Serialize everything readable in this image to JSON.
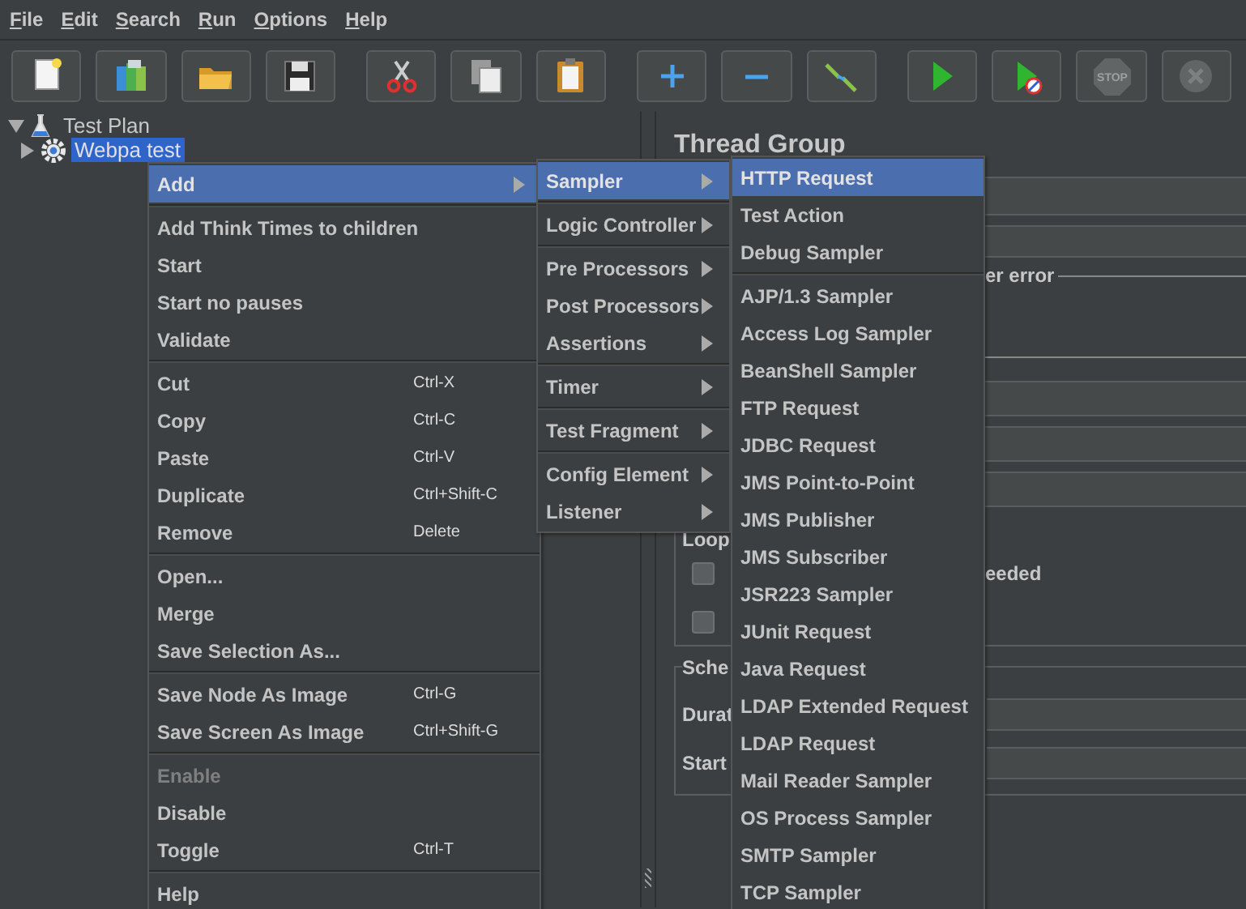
{
  "menu_bar": [
    {
      "label": "File"
    },
    {
      "label": "Edit"
    },
    {
      "label": "Search"
    },
    {
      "label": "Run"
    },
    {
      "label": "Options"
    },
    {
      "label": "Help"
    }
  ],
  "toolbar": [
    {
      "kind": "new",
      "disabled": false
    },
    {
      "kind": "templates",
      "disabled": false
    },
    {
      "kind": "open",
      "disabled": false
    },
    {
      "kind": "save",
      "disabled": false
    },
    {
      "kind": "cut",
      "disabled": false
    },
    {
      "kind": "copy",
      "disabled": false
    },
    {
      "kind": "paste",
      "disabled": false
    },
    {
      "kind": "expand",
      "disabled": false
    },
    {
      "kind": "collapse",
      "disabled": false
    },
    {
      "kind": "toggle",
      "disabled": false
    },
    {
      "kind": "start",
      "disabled": false
    },
    {
      "kind": "start_no_pauses",
      "disabled": false
    },
    {
      "kind": "stop",
      "disabled": true,
      "text": "STOP"
    },
    {
      "kind": "shutdown",
      "disabled": true
    }
  ],
  "tree": [
    {
      "label": "Test Plan",
      "kind": "test_plan",
      "expanded": true,
      "selected": false,
      "children": [
        {
          "label": "Webpa test",
          "kind": "thread_group",
          "expanded": false,
          "selected": true
        }
      ]
    }
  ],
  "panel": {
    "title": "Thread Group",
    "error_group_label": "er error",
    "loop_label": "Loop",
    "checkboxes": [
      {
        "checked": false,
        "label": "eeded"
      },
      {
        "checked": false
      }
    ],
    "scheduler_label": "Sche",
    "scheduler_rows": [
      "Durat",
      "Start"
    ]
  },
  "context_menus": [
    {
      "sections": [
        {
          "items": [
            {
              "label": "Add",
              "submenu": true,
              "selected": true,
              "disabled": false
            }
          ]
        },
        {
          "items": [
            {
              "label": "Add Think Times to children",
              "submenu": false,
              "selected": false,
              "disabled": false
            },
            {
              "label": "Start",
              "submenu": false,
              "selected": false,
              "disabled": false
            },
            {
              "label": "Start no pauses",
              "submenu": false,
              "selected": false,
              "disabled": false
            },
            {
              "label": "Validate",
              "submenu": false,
              "selected": false,
              "disabled": false
            }
          ]
        },
        {
          "items": [
            {
              "label": "Cut",
              "shortcut": "Ctrl-X",
              "submenu": false,
              "selected": false,
              "disabled": false
            },
            {
              "label": "Copy",
              "shortcut": "Ctrl-C",
              "submenu": false,
              "selected": false,
              "disabled": false
            },
            {
              "label": "Paste",
              "shortcut": "Ctrl-V",
              "submenu": false,
              "selected": false,
              "disabled": false
            },
            {
              "label": "Duplicate",
              "shortcut": "Ctrl+Shift-C",
              "submenu": false,
              "selected": false,
              "disabled": false
            },
            {
              "label": "Remove",
              "shortcut": "Delete",
              "submenu": false,
              "selected": false,
              "disabled": false
            }
          ]
        },
        {
          "items": [
            {
              "label": "Open...",
              "submenu": false,
              "selected": false,
              "disabled": false
            },
            {
              "label": "Merge",
              "submenu": false,
              "selected": false,
              "disabled": false
            },
            {
              "label": "Save Selection As...",
              "submenu": false,
              "selected": false,
              "disabled": false
            }
          ]
        },
        {
          "items": [
            {
              "label": "Save Node As Image",
              "shortcut": "Ctrl-G",
              "submenu": false,
              "selected": false,
              "disabled": false
            },
            {
              "label": "Save Screen As Image",
              "shortcut": "Ctrl+Shift-G",
              "submenu": false,
              "selected": false,
              "disabled": false
            }
          ]
        },
        {
          "items": [
            {
              "label": "Enable",
              "submenu": false,
              "selected": false,
              "disabled": true
            },
            {
              "label": "Disable",
              "submenu": false,
              "selected": false,
              "disabled": false
            },
            {
              "label": "Toggle",
              "shortcut": "Ctrl-T",
              "submenu": false,
              "selected": false,
              "disabled": false
            }
          ]
        },
        {
          "items": [
            {
              "label": "Help",
              "submenu": false,
              "selected": false,
              "disabled": false
            }
          ]
        }
      ]
    },
    {
      "sections": [
        {
          "items": [
            {
              "label": "Sampler",
              "submenu": true,
              "selected": true,
              "disabled": false
            }
          ]
        },
        {
          "items": [
            {
              "label": "Logic Controller",
              "submenu": true,
              "selected": false,
              "disabled": false
            }
          ]
        },
        {
          "items": [
            {
              "label": "Pre Processors",
              "submenu": true,
              "selected": false,
              "disabled": false
            },
            {
              "label": "Post Processors",
              "submenu": true,
              "selected": false,
              "disabled": false
            },
            {
              "label": "Assertions",
              "submenu": true,
              "selected": false,
              "disabled": false
            }
          ]
        },
        {
          "items": [
            {
              "label": "Timer",
              "submenu": true,
              "selected": false,
              "disabled": false
            }
          ]
        },
        {
          "items": [
            {
              "label": "Test Fragment",
              "submenu": true,
              "selected": false,
              "disabled": false
            }
          ]
        },
        {
          "items": [
            {
              "label": "Config Element",
              "submenu": true,
              "selected": false,
              "disabled": false
            },
            {
              "label": "Listener",
              "submenu": true,
              "selected": false,
              "disabled": false
            }
          ]
        }
      ]
    },
    {
      "sections": [
        {
          "items": [
            {
              "label": "HTTP Request",
              "submenu": false,
              "selected": true,
              "disabled": false
            },
            {
              "label": "Test Action",
              "submenu": false,
              "selected": false,
              "disabled": false
            },
            {
              "label": "Debug Sampler",
              "submenu": false,
              "selected": false,
              "disabled": false
            }
          ]
        },
        {
          "items": [
            {
              "label": "AJP/1.3 Sampler",
              "submenu": false,
              "selected": false,
              "disabled": false
            },
            {
              "label": "Access Log Sampler",
              "submenu": false,
              "selected": false,
              "disabled": false
            },
            {
              "label": "BeanShell Sampler",
              "submenu": false,
              "selected": false,
              "disabled": false
            },
            {
              "label": "FTP Request",
              "submenu": false,
              "selected": false,
              "disabled": false
            },
            {
              "label": "JDBC Request",
              "submenu": false,
              "selected": false,
              "disabled": false
            },
            {
              "label": "JMS Point-to-Point",
              "submenu": false,
              "selected": false,
              "disabled": false
            },
            {
              "label": "JMS Publisher",
              "submenu": false,
              "selected": false,
              "disabled": false
            },
            {
              "label": "JMS Subscriber",
              "submenu": false,
              "selected": false,
              "disabled": false
            },
            {
              "label": "JSR223 Sampler",
              "submenu": false,
              "selected": false,
              "disabled": false
            },
            {
              "label": "JUnit Request",
              "submenu": false,
              "selected": false,
              "disabled": false
            },
            {
              "label": "Java Request",
              "submenu": false,
              "selected": false,
              "disabled": false
            },
            {
              "label": "LDAP Extended Request",
              "submenu": false,
              "selected": false,
              "disabled": false
            },
            {
              "label": "LDAP Request",
              "submenu": false,
              "selected": false,
              "disabled": false
            },
            {
              "label": "Mail Reader Sampler",
              "submenu": false,
              "selected": false,
              "disabled": false
            },
            {
              "label": "OS Process Sampler",
              "submenu": false,
              "selected": false,
              "disabled": false
            },
            {
              "label": "SMTP Sampler",
              "submenu": false,
              "selected": false,
              "disabled": false
            },
            {
              "label": "TCP Sampler",
              "submenu": false,
              "selected": false,
              "disabled": false
            }
          ]
        }
      ]
    }
  ]
}
